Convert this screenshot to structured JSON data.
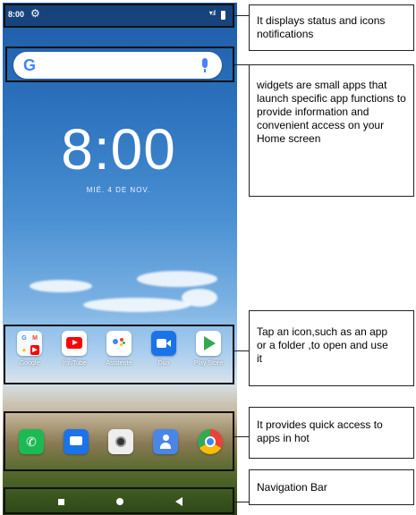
{
  "status_bar": {
    "time": "8:00",
    "settings_icon": "gear-icon",
    "signal_icon": "wifi-signal-icon",
    "battery_icon": "battery-icon"
  },
  "search_widget": {
    "logo": "G",
    "mic_icon": "mic-icon"
  },
  "clock_widget": {
    "time": "8:00",
    "date": "MIÉ. 4 DE NOV."
  },
  "apps_row": [
    {
      "label": "Google",
      "icon": "google-folder-icon"
    },
    {
      "label": "YouTube",
      "icon": "youtube-icon",
      "color": "#ff0000"
    },
    {
      "label": "Asistente",
      "icon": "assistant-icon",
      "color": "#4285f4"
    },
    {
      "label": "Duo",
      "icon": "duo-icon",
      "color": "#1a73e8"
    },
    {
      "label": "Play Store",
      "icon": "play-store-icon",
      "color": "#34a853"
    }
  ],
  "hotseat": [
    {
      "icon": "phone-icon",
      "color": "#1db954"
    },
    {
      "icon": "messages-icon",
      "color": "#1a73e8"
    },
    {
      "icon": "camera-icon",
      "color": "#eeeeee"
    },
    {
      "icon": "contacts-icon",
      "color": "#4a86e8"
    },
    {
      "icon": "chrome-icon",
      "color": "#ffffff"
    }
  ],
  "nav_bar": {
    "recent_icon": "square-recent-icon",
    "home_icon": "circle-home-icon",
    "back_icon": "triangle-back-icon"
  },
  "annotations": {
    "status": "It displays status and icons notifications",
    "widgets": "widgets are small apps that launch specific app functions to provide information and convenient access on your Home screen",
    "apps": "Tap an icon,such as an app or a folder ,to open and use it",
    "hotseat": "It provides quick access to apps in hot",
    "nav": "Navigation Bar"
  }
}
